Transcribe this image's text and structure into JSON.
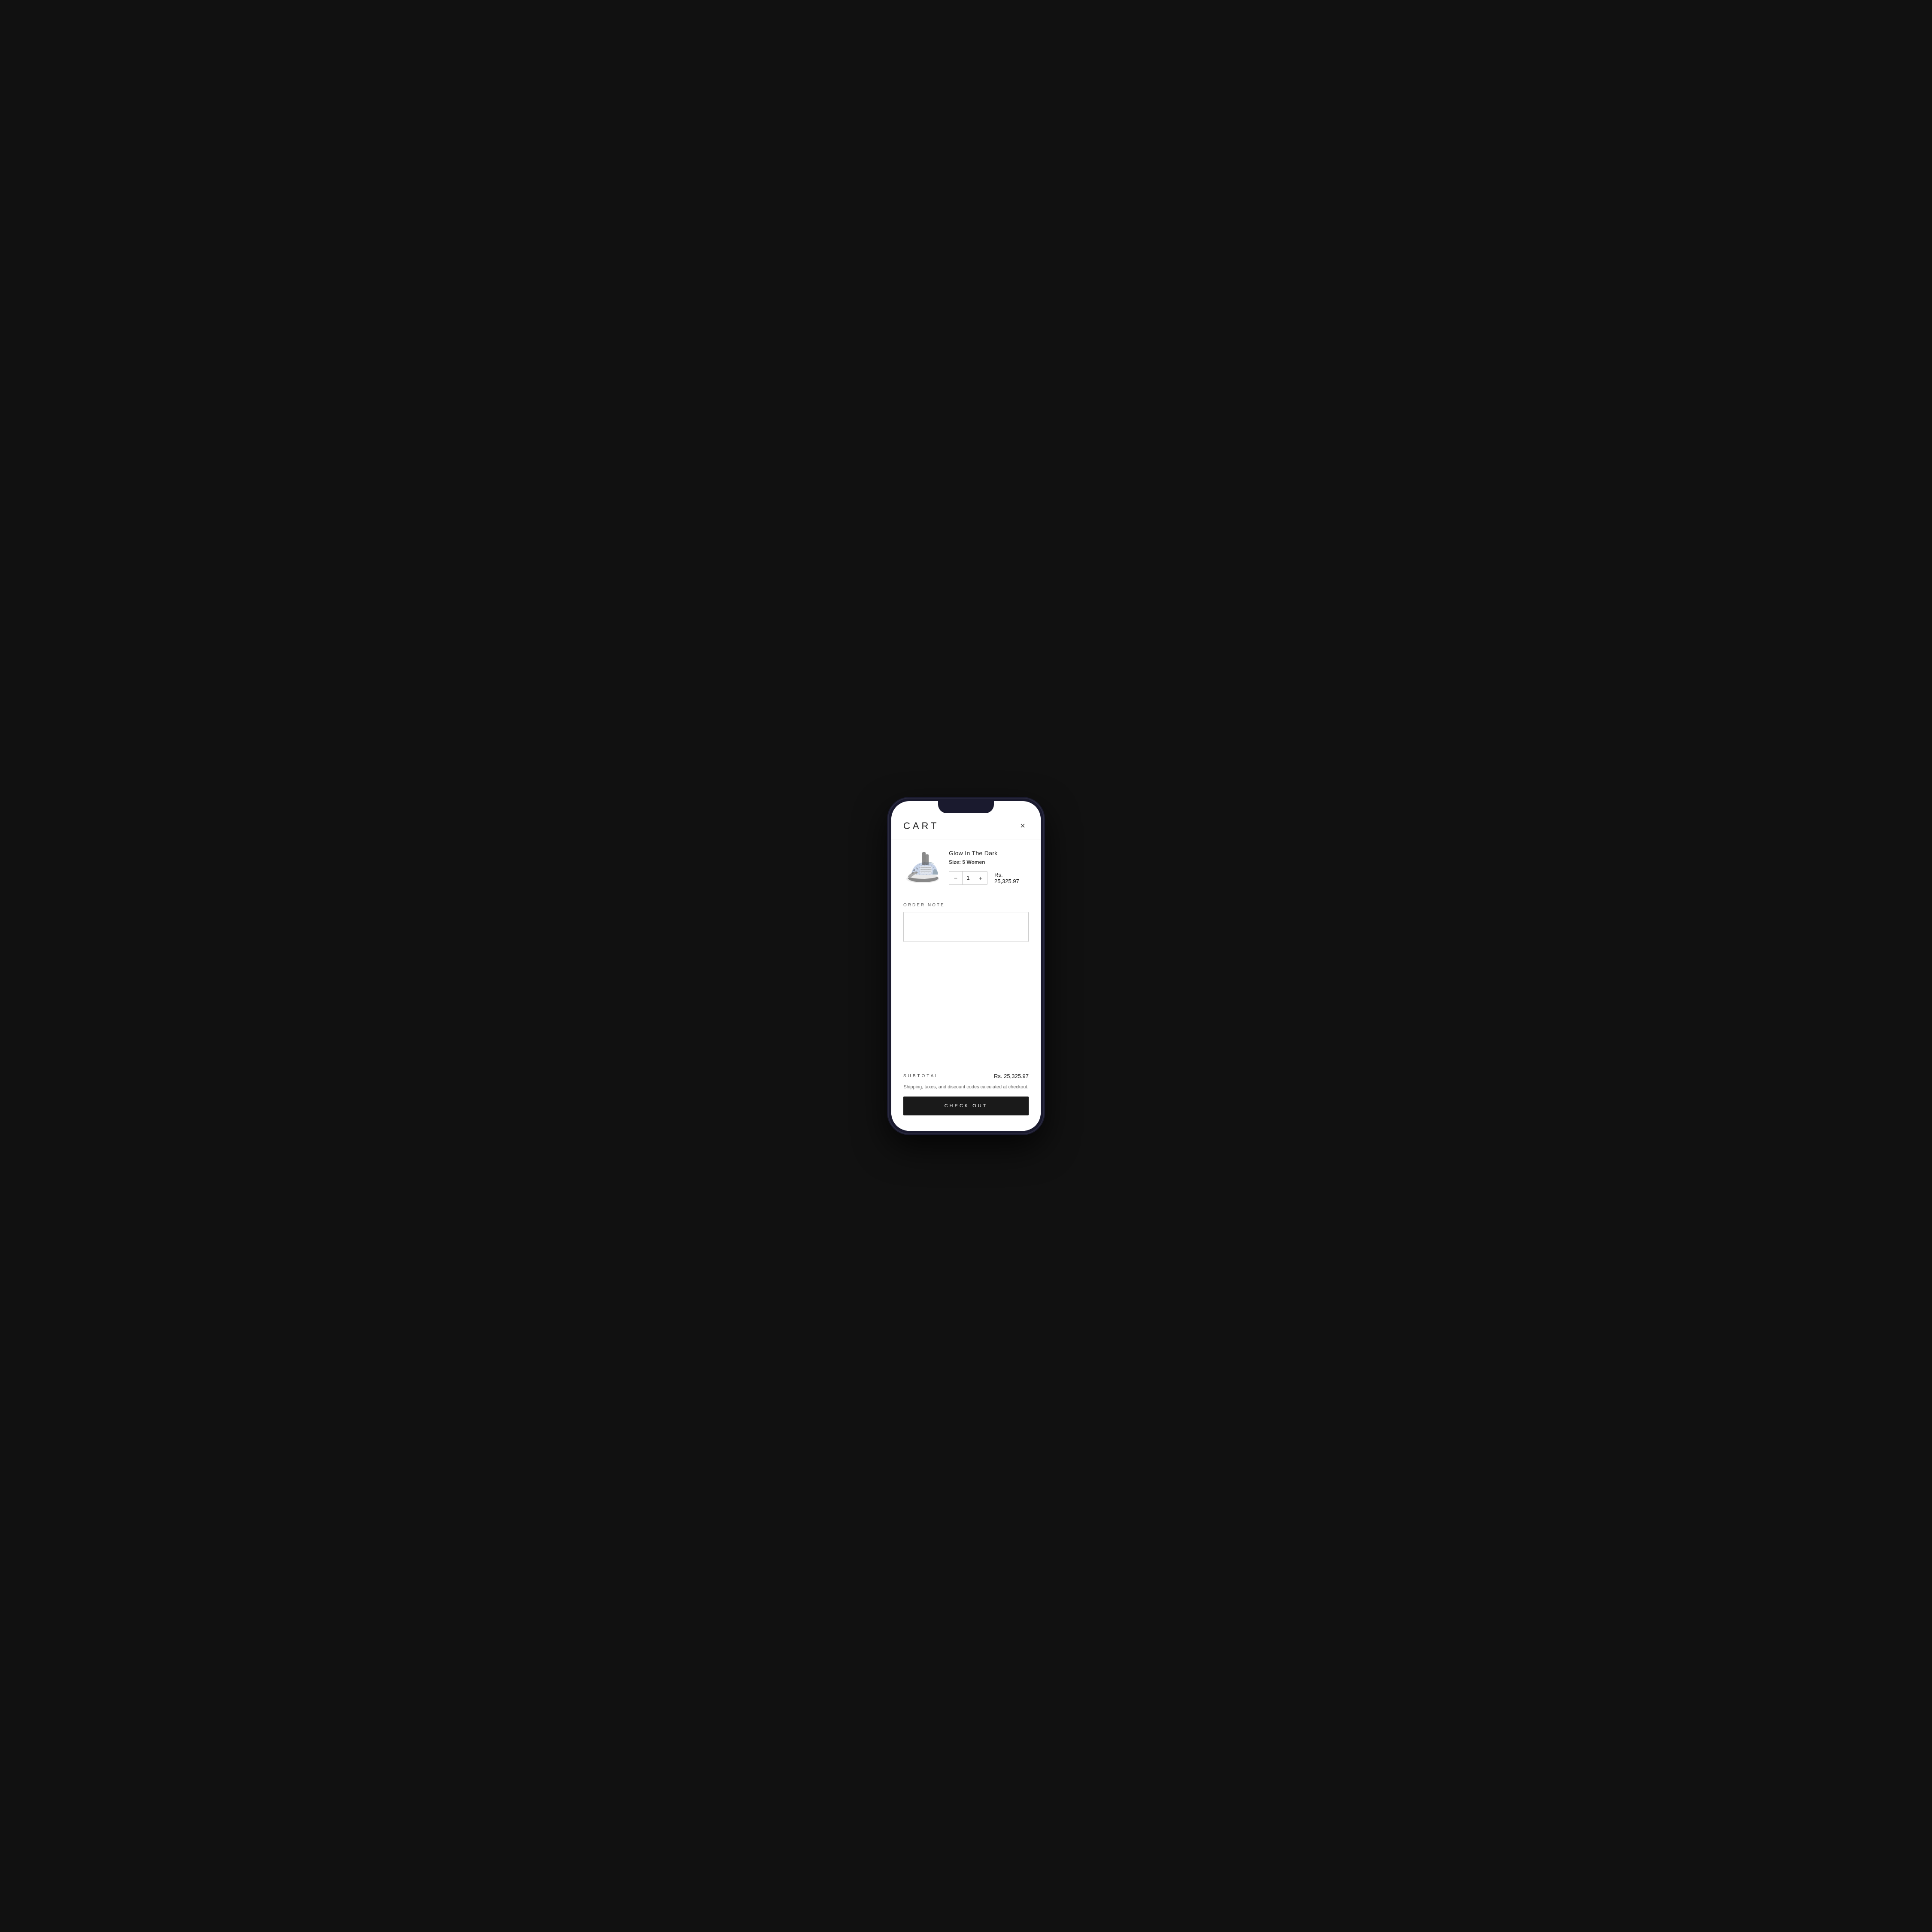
{
  "header": {
    "title": "CART",
    "close_label": "×"
  },
  "product": {
    "name": "Glow In The Dark",
    "size_label": "Size:",
    "size_value": "5 Women",
    "quantity": 1,
    "price": "Rs. 25,325.97"
  },
  "order_note": {
    "label": "ORDER NOTE",
    "placeholder": ""
  },
  "summary": {
    "subtotal_label": "SUBTOTAL",
    "subtotal_amount": "Rs. 25,325.97",
    "shipping_note": "Shipping, taxes, and discount codes calculated at checkout."
  },
  "checkout": {
    "button_label": "CHECK OUT"
  },
  "qty": {
    "minus": "−",
    "plus": "+"
  }
}
